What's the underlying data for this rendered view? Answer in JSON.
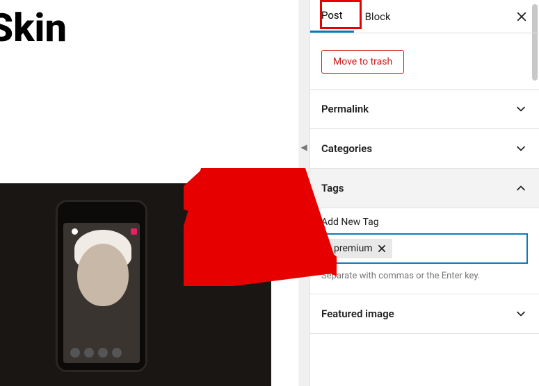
{
  "editor": {
    "title_fragment": "e Skin"
  },
  "sidebar": {
    "tabs": {
      "post": "Post",
      "block": "Block"
    },
    "active_tab": "post",
    "move_to_trash": "Move to trash",
    "panels": {
      "permalink": "Permalink",
      "categories": "Categories",
      "tags": "Tags",
      "featured_image": "Featured image"
    },
    "tags": {
      "heading": "Tags",
      "add_label": "Add New Tag",
      "hint": "Separate with commas or the Enter key.",
      "items": [
        "premium"
      ],
      "input_value": ""
    }
  }
}
